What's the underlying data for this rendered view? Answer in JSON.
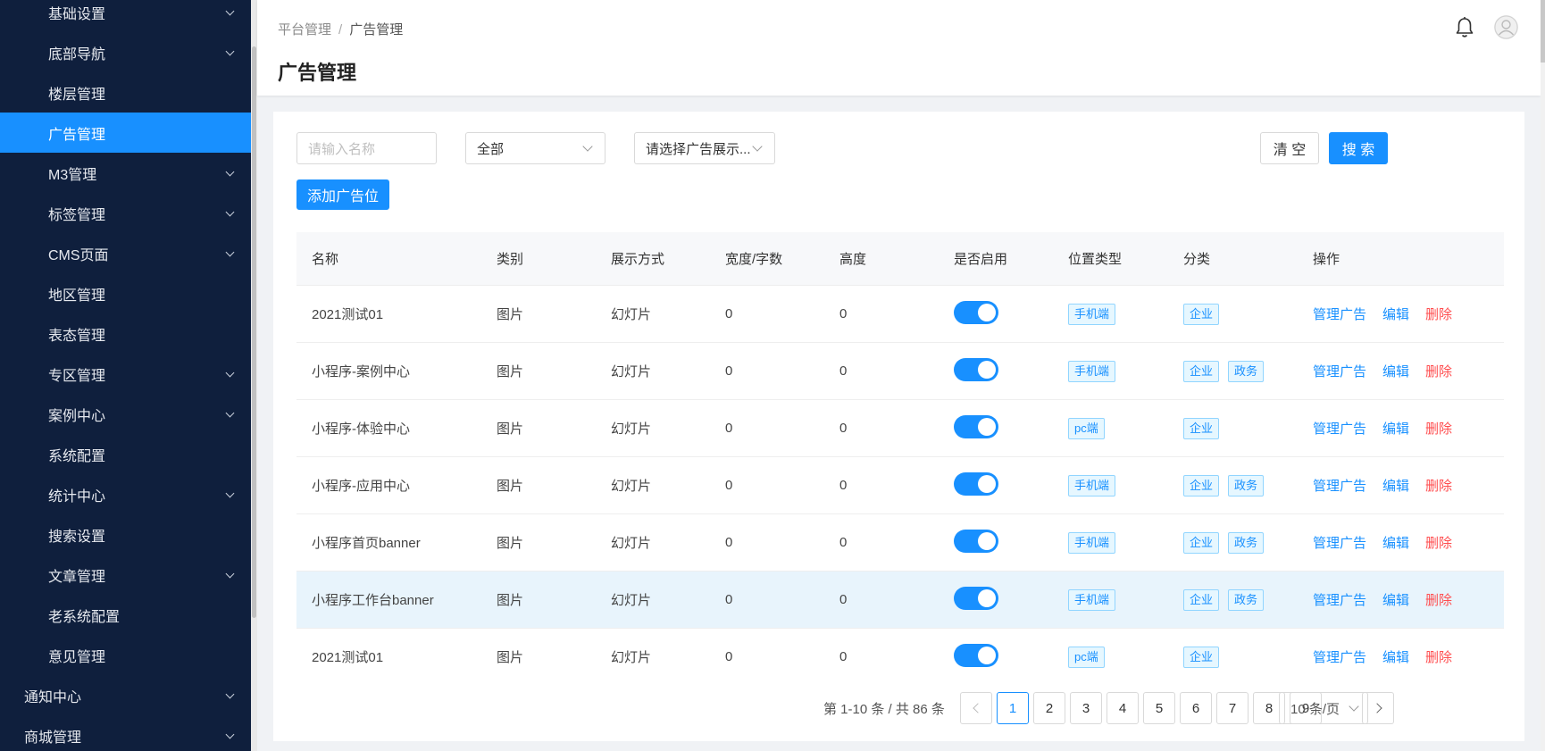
{
  "sidebar": {
    "items": [
      {
        "label": "基础设置",
        "chevron": true,
        "level": 2
      },
      {
        "label": "底部导航",
        "chevron": true,
        "level": 2
      },
      {
        "label": "楼层管理",
        "chevron": false,
        "level": 2
      },
      {
        "label": "广告管理",
        "chevron": false,
        "level": 2,
        "active": true
      },
      {
        "label": "M3管理",
        "chevron": true,
        "level": 2
      },
      {
        "label": "标签管理",
        "chevron": true,
        "level": 2
      },
      {
        "label": "CMS页面",
        "chevron": true,
        "level": 2
      },
      {
        "label": "地区管理",
        "chevron": false,
        "level": 2
      },
      {
        "label": "表态管理",
        "chevron": false,
        "level": 2
      },
      {
        "label": "专区管理",
        "chevron": true,
        "level": 2
      },
      {
        "label": "案例中心",
        "chevron": true,
        "level": 2
      },
      {
        "label": "系统配置",
        "chevron": false,
        "level": 2
      },
      {
        "label": "统计中心",
        "chevron": true,
        "level": 2
      },
      {
        "label": "搜索设置",
        "chevron": false,
        "level": 2
      },
      {
        "label": "文章管理",
        "chevron": true,
        "level": 2
      },
      {
        "label": "老系统配置",
        "chevron": false,
        "level": 2
      },
      {
        "label": "意见管理",
        "chevron": false,
        "level": 2
      },
      {
        "label": "通知中心",
        "chevron": true,
        "level": 1
      },
      {
        "label": "商城管理",
        "chevron": true,
        "level": 1
      }
    ]
  },
  "header": {
    "breadcrumb": [
      "平台管理",
      "广告管理"
    ],
    "title": "广告管理",
    "bell_icon": "bell-icon",
    "avatar_icon": "user-avatar-icon"
  },
  "filters": {
    "name_placeholder": "请输入名称",
    "category_value": "全部",
    "display_placeholder": "请选择广告展示...",
    "clear_label": "清 空",
    "search_label": "搜 索",
    "add_label": "添加广告位"
  },
  "table": {
    "columns": [
      "名称",
      "类别",
      "展示方式",
      "宽度/字数",
      "高度",
      "是否启用",
      "位置类型",
      "分类",
      "操作"
    ],
    "rows": [
      {
        "name": "2021测试01",
        "type": "图片",
        "mode": "幻灯片",
        "width": "0",
        "height": "0",
        "enabled": true,
        "position": "手机端",
        "categories": [
          "企业"
        ]
      },
      {
        "name": "小程序-案例中心",
        "type": "图片",
        "mode": "幻灯片",
        "width": "0",
        "height": "0",
        "enabled": true,
        "position": "手机端",
        "categories": [
          "企业",
          "政务"
        ]
      },
      {
        "name": "小程序-体验中心",
        "type": "图片",
        "mode": "幻灯片",
        "width": "0",
        "height": "0",
        "enabled": true,
        "position": "pc端",
        "categories": [
          "企业"
        ]
      },
      {
        "name": "小程序-应用中心",
        "type": "图片",
        "mode": "幻灯片",
        "width": "0",
        "height": "0",
        "enabled": true,
        "position": "手机端",
        "categories": [
          "企业",
          "政务"
        ]
      },
      {
        "name": "小程序首页banner",
        "type": "图片",
        "mode": "幻灯片",
        "width": "0",
        "height": "0",
        "enabled": true,
        "position": "手机端",
        "categories": [
          "企业",
          "政务"
        ]
      },
      {
        "name": "小程序工作台banner",
        "type": "图片",
        "mode": "幻灯片",
        "width": "0",
        "height": "0",
        "enabled": true,
        "position": "手机端",
        "categories": [
          "企业",
          "政务"
        ],
        "highlight": true
      },
      {
        "name": "2021测试01",
        "type": "图片",
        "mode": "幻灯片",
        "width": "0",
        "height": "0",
        "enabled": true,
        "position": "pc端",
        "categories": [
          "企业"
        ]
      }
    ],
    "actions": {
      "manage": "管理广告",
      "edit": "编辑",
      "delete": "删除"
    }
  },
  "pagination": {
    "total_text": "第 1-10 条 / 共 86 条",
    "pages": [
      "1",
      "2",
      "3",
      "4",
      "5",
      "6",
      "7",
      "8",
      "9"
    ],
    "current": "1",
    "page_size": "10 条/页"
  },
  "colors": {
    "sidebar_bg": "#0f1f3d",
    "accent": "#1890ff",
    "danger": "#ff4d4f"
  }
}
